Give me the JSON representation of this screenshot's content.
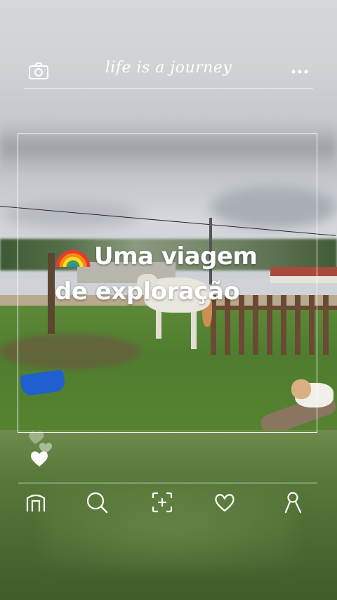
{
  "header": {
    "title": "life is a journey",
    "left_icon": "camera-icon",
    "right_icon": "more-icon"
  },
  "post": {
    "caption_line1": "Uma viagem",
    "caption_line2": "de exploração",
    "emoji": "rainbow-icon",
    "like_icon": "heart-icon"
  },
  "nav": {
    "items": [
      {
        "icon": "home-icon"
      },
      {
        "icon": "search-icon"
      },
      {
        "icon": "add-post-icon"
      },
      {
        "icon": "heart-icon"
      },
      {
        "icon": "profile-icon"
      }
    ]
  },
  "colors": {
    "overlay_line": "#ffffff",
    "bucket": "#1f5fd0",
    "grass": "#5c8a38"
  }
}
